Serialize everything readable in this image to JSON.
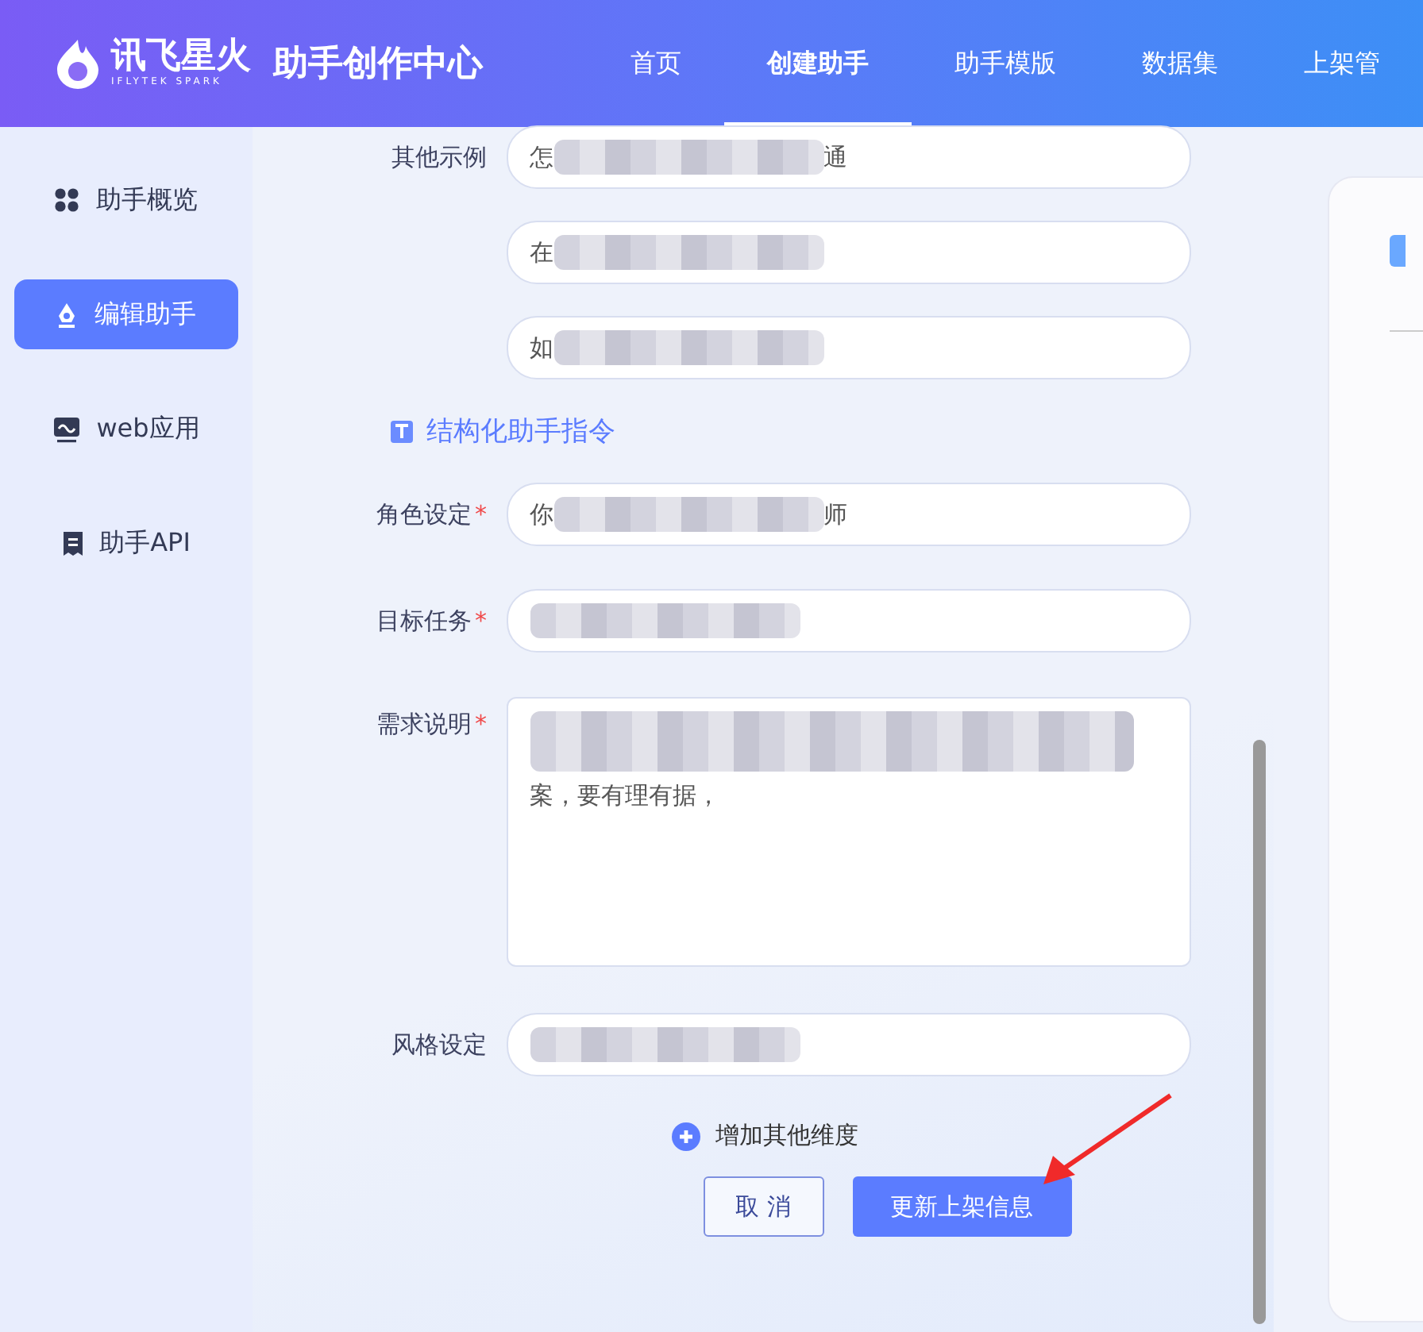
{
  "brand": {
    "name": "讯飞星火",
    "subtitle": "IFLYTEK SPARK",
    "title": "助手创作中心"
  },
  "nav": [
    {
      "label": "首页",
      "selected": false
    },
    {
      "label": "创建助手",
      "selected": true
    },
    {
      "label": "助手模版",
      "selected": false
    },
    {
      "label": "数据集",
      "selected": false
    },
    {
      "label": "上架管",
      "selected": false
    }
  ],
  "sidebar": [
    {
      "label": "助手概览",
      "selected": false
    },
    {
      "label": "编辑助手",
      "selected": true
    },
    {
      "label": "web应用",
      "selected": false
    },
    {
      "label": "助手API",
      "selected": false
    }
  ],
  "examples": {
    "label": "其他示例",
    "fields": [
      {
        "text_before": "怎",
        "text_after": "通"
      },
      {
        "text_before": "在"
      },
      {
        "text_before": "如"
      }
    ]
  },
  "section_title": "结构化助手指令",
  "fields": [
    {
      "label": "角色设定",
      "required_mark": "*",
      "kind": "input",
      "text_before": "你",
      "text_after": "师"
    },
    {
      "label": "目标任务",
      "required_mark": "*",
      "kind": "input"
    },
    {
      "label": "需求说明",
      "required_mark": "*",
      "kind": "textarea",
      "text_after": "案，要有理有据，"
    },
    {
      "label": "风格设定",
      "kind": "input"
    }
  ],
  "add_dimension": "增加其他维度",
  "buttons": {
    "cancel": "取 消",
    "submit": "更新上架信息"
  }
}
